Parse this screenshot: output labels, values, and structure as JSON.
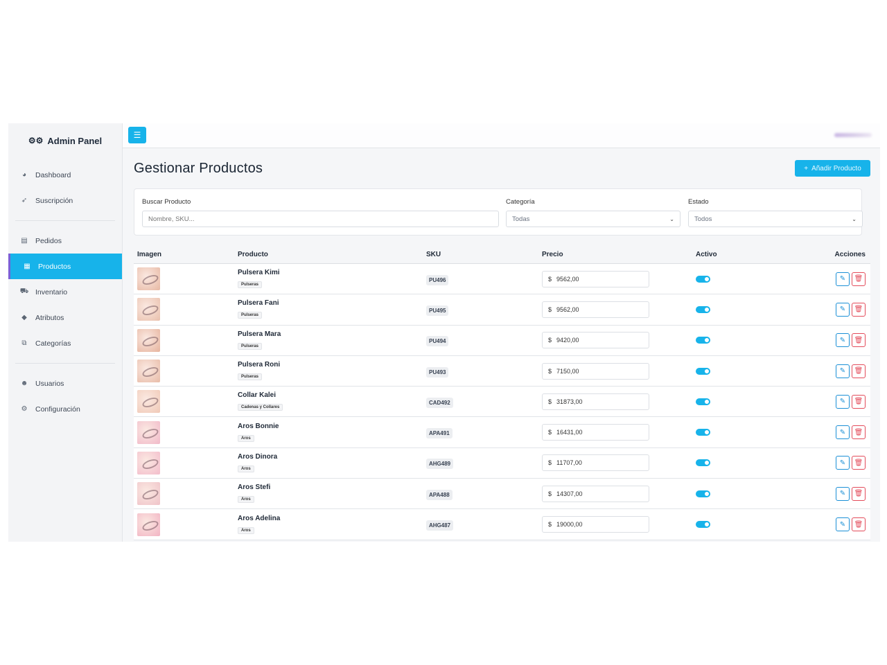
{
  "sidebar": {
    "brand": "Admin Panel",
    "brand_icon": "gears-icon",
    "items": [
      {
        "label": "Dashboard",
        "icon": "◕"
      },
      {
        "label": "Suscripción",
        "icon": "🚀"
      },
      {
        "label": "Pedidos",
        "icon": "▤"
      },
      {
        "label": "Productos",
        "icon": "▦"
      },
      {
        "label": "Inventario",
        "icon": "⚙"
      },
      {
        "label": "Atributos",
        "icon": "◆"
      },
      {
        "label": "Categorías",
        "icon": "⧉"
      },
      {
        "label": "Usuarios",
        "icon": "👥"
      },
      {
        "label": "Configuración",
        "icon": "⚙"
      }
    ]
  },
  "header": {
    "menu_icon": "☰"
  },
  "page": {
    "title": "Gestionar Productos",
    "add_button": "Añadir Producto",
    "add_icon": "+"
  },
  "filters": {
    "search_label": "Buscar Producto",
    "search_placeholder": "Nombre, SKU...",
    "category_label": "Categoría",
    "category_value": "Todas",
    "status_label": "Estado",
    "status_value": "Todos"
  },
  "table": {
    "headers": {
      "image": "Imagen",
      "product": "Producto",
      "sku": "SKU",
      "price": "Precio",
      "active": "Activo",
      "actions": "Acciones"
    },
    "currency": "$",
    "rows": [
      {
        "name": "Pulsera Kimi",
        "category": "Pulseras",
        "sku": "PU496",
        "price": "9562,00",
        "active": true,
        "thumb": "#e7b8a3"
      },
      {
        "name": "Pulsera Fani",
        "category": "Pulseras",
        "sku": "PU495",
        "price": "9562,00",
        "active": true,
        "thumb": "#e9c0ac"
      },
      {
        "name": "Pulsera Mara",
        "category": "Pulseras",
        "sku": "PU494",
        "price": "9420,00",
        "active": true,
        "thumb": "#e6b39d"
      },
      {
        "name": "Pulsera Roni",
        "category": "Pulseras",
        "sku": "PU493",
        "price": "7150,00",
        "active": true,
        "thumb": "#e8bba7"
      },
      {
        "name": "Collar Kalei",
        "category": "Cadenas y Collares",
        "sku": "CAD492",
        "price": "31873,00",
        "active": true,
        "thumb": "#f0c9b6"
      },
      {
        "name": "Aros Bonnie",
        "category": "Aros",
        "sku": "APA491",
        "price": "16431,00",
        "active": true,
        "thumb": "#f1b9c9"
      },
      {
        "name": "Aros Dinora",
        "category": "Aros",
        "sku": "AHG489",
        "price": "11707,00",
        "active": true,
        "thumb": "#f3bccb"
      },
      {
        "name": "Aros Stefi",
        "category": "Aros",
        "sku": "APA488",
        "price": "14307,00",
        "active": true,
        "thumb": "#efc2c8"
      },
      {
        "name": "Aros Adelina",
        "category": "Aros",
        "sku": "AHG487",
        "price": "19000,00",
        "active": true,
        "thumb": "#f2b3c3"
      }
    ]
  }
}
